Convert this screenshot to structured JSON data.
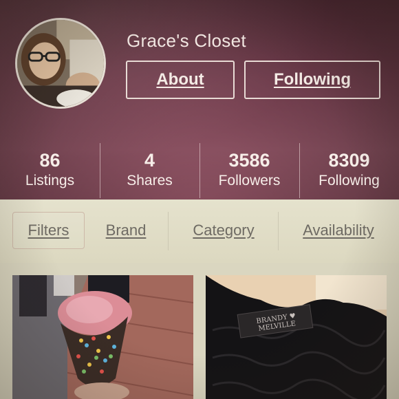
{
  "profile": {
    "shop_name": "Grace's Closet",
    "about_label": "About",
    "following_label": "Following"
  },
  "stats": [
    {
      "value": "86",
      "label": "Listings"
    },
    {
      "value": "4",
      "label": "Shares"
    },
    {
      "value": "3586",
      "label": "Followers"
    },
    {
      "value": "8309",
      "label": "Following"
    }
  ],
  "filters": {
    "tabs": [
      {
        "label": "Filters",
        "active": true
      },
      {
        "label": "Brand",
        "active": false
      },
      {
        "label": "Category",
        "active": false
      },
      {
        "label": "Availability",
        "active": false
      }
    ]
  },
  "listings": [
    {
      "image": "ice-cream-cone-photo"
    },
    {
      "image": "black-sweater-photo",
      "tag_text": "BRANDY ♥ MELVILLE"
    }
  ],
  "colors": {
    "header": "#8b4a5e",
    "header_text": "#f3e8e3",
    "filter_bg": "#e3e0ca",
    "filter_text": "#6e6a63"
  }
}
